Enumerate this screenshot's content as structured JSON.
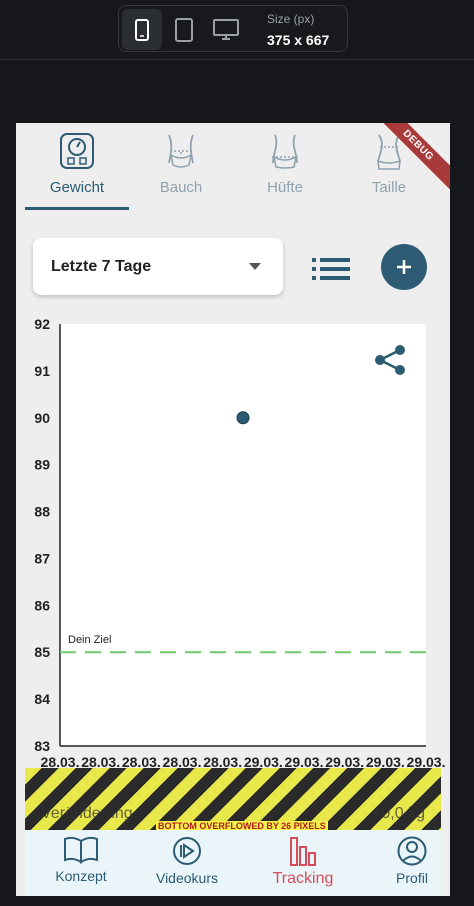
{
  "devtools": {
    "size_label": "Size (px)",
    "size_value": "375 x 667"
  },
  "debug_banner": "DEBUG",
  "tabs": [
    {
      "label": "Gewicht",
      "icon": "scale-icon",
      "active": true
    },
    {
      "label": "Bauch",
      "icon": "belly-icon",
      "active": false
    },
    {
      "label": "Hüfte",
      "icon": "hip-icon",
      "active": false
    },
    {
      "label": "Taille",
      "icon": "waist-icon",
      "active": false
    }
  ],
  "period_select": {
    "value": "Letzte 7 Tage"
  },
  "chart_data": {
    "type": "scatter",
    "y_ticks": [
      "92",
      "91",
      "90",
      "89",
      "88",
      "87",
      "86",
      "85",
      "84",
      "83"
    ],
    "ylim": [
      83,
      92
    ],
    "x_labels": [
      "28.03.",
      "28.03.",
      "28.03.",
      "28.03.",
      "28.03.",
      "29.03.",
      "29.03.",
      "29.03.",
      "29.03.",
      "29.03."
    ],
    "points": [
      {
        "x_index": 5,
        "y": 90
      }
    ],
    "goal": {
      "label": "Dein Ziel",
      "value": 85
    },
    "goal_color": "#6ec96a",
    "point_color": "#2d5b73"
  },
  "overflow": {
    "row_label": "Veränderung",
    "row_value": "+0,0 kg",
    "warning": "BOTTOM OVERFLOWED BY 26 PIXELS"
  },
  "bottom_nav": [
    {
      "label": "Konzept",
      "icon": "book-icon",
      "active": false
    },
    {
      "label": "Videokurs",
      "icon": "play-circle-icon",
      "active": false
    },
    {
      "label": "Tracking",
      "icon": "bar-chart-icon",
      "active": true
    },
    {
      "label": "Profil",
      "icon": "person-icon",
      "active": false
    }
  ],
  "colors": {
    "primary": "#2d5b73",
    "accent": "#d94b5b",
    "debug": "#a93a3a"
  }
}
